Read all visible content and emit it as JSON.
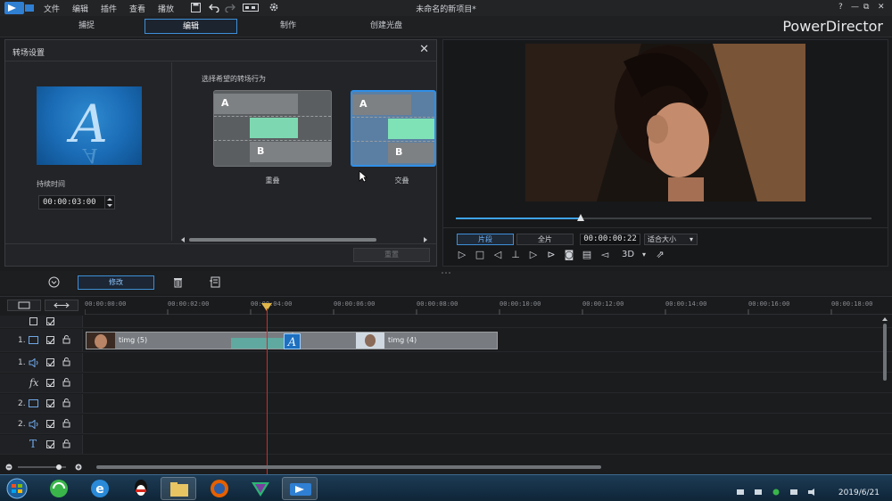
{
  "menu": [
    "文件",
    "编辑",
    "插件",
    "查看",
    "播放"
  ],
  "window_title": "未命名的新项目*",
  "window_controls": [
    "?",
    "—",
    "⧉",
    "✕"
  ],
  "tabs": [
    {
      "label": "捕捉",
      "active": false
    },
    {
      "label": "编辑",
      "active": true
    },
    {
      "label": "制作",
      "active": false
    },
    {
      "label": "创建光盘",
      "active": false
    }
  ],
  "brand": "PowerDirector",
  "transition_panel": {
    "title": "转场设置",
    "close": "✕",
    "duration_label": "持续时间",
    "duration_value": "00:00:03:00",
    "select_label": "选择希望的转场行为",
    "options": [
      {
        "label": "重叠",
        "a": "A",
        "b": "B",
        "selected": false
      },
      {
        "label": "交叠",
        "a": "A",
        "b": "B",
        "selected": true
      }
    ],
    "reset_label": "重置"
  },
  "preview": {
    "progress": 0.3,
    "mode_clip": "片段",
    "mode_full": "全片",
    "timecode": "00:00:00:22",
    "fit": "适合大小",
    "three_d": "3D"
  },
  "toolbar": {
    "modify_label": "修改"
  },
  "timeline": {
    "ticks": [
      "00:00:00:00",
      "00:00:02:00",
      "00:00:04:00",
      "00:00:06:00",
      "00:00:08:00",
      "00:00:10:00",
      "00:00:12:00",
      "00:00:14:00",
      "00:00:16:00",
      "00:00:18:00"
    ],
    "tracks": [
      {
        "num": "",
        "icon": "checkbox-all"
      },
      {
        "num": "1.",
        "icon": "video-track-icon"
      },
      {
        "num": "1.",
        "icon": "audio-track-icon"
      },
      {
        "num": "",
        "icon": "fx-track-icon",
        "glyph": "fx"
      },
      {
        "num": "2.",
        "icon": "video-track-icon"
      },
      {
        "num": "2.",
        "icon": "audio-track-icon"
      },
      {
        "num": "",
        "icon": "title-track-icon",
        "glyph": "T"
      }
    ],
    "clips": [
      {
        "label": "timg (5)"
      },
      {
        "label": "timg (4)"
      }
    ]
  },
  "taskbar": {
    "apps": [
      "start-orb-icon",
      "360-browser-icon",
      "ie-browser-icon",
      "qq-icon",
      "file-explorer-icon",
      "firefox-icon",
      "media-app-icon",
      "powerdirector-icon"
    ],
    "date": "2019/6/21"
  }
}
